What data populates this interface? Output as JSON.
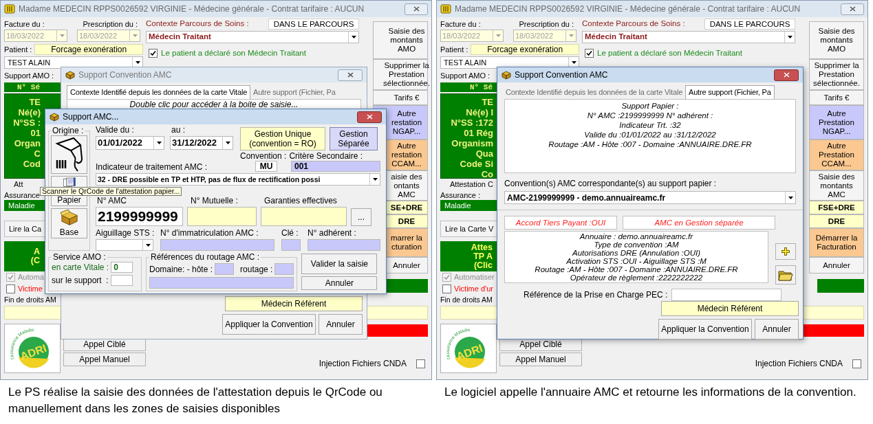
{
  "panels": [
    {
      "main_window": {
        "title": "Madame MEDECIN RPPS0026592 VIRGINIE - Médecine générale - Contrat tarifaire : AUCUN",
        "facture": {
          "label": "Facture du :",
          "value": "18/03/2022",
          "disabled": true
        },
        "prescription": {
          "label": "Prescription du :",
          "value": "18/03/2022",
          "disabled": true
        },
        "patient_label": "Patient :",
        "forcage_button": "Forcage exonération",
        "patient": "TEST ALAIN",
        "support_amo_label": "Support AMO :",
        "serie_bar": "N° Sé",
        "carte_lines": [
          "TE",
          "Né(e)",
          "N°SS :",
          "01",
          "Organ",
          "C",
          "Cod"
        ],
        "attestation_label": "Att",
        "assurance_label": "Assurance",
        "regime": "Maladie",
        "read_card_button": "Lire la Ca",
        "attestation_lines": [
          "A",
          "(C"
        ],
        "options": [
          {
            "label": "Automa",
            "checked": true,
            "disabled": true,
            "kind": "normal"
          },
          {
            "label": "Victime",
            "checked": false,
            "disabled": false,
            "kind": "alert"
          }
        ],
        "fin_droits": "Fin de droits AM",
        "parcours": {
          "label": "Contexte Parcours de Soins :",
          "status": "DANS LE PARCOURS",
          "value": "Médecin Traitant",
          "declared": {
            "label": "Le patient a déclaré son Médecin Traitant",
            "checked": true
          }
        },
        "side_buttons": [
          {
            "lines": [
              "Saisie des",
              "montants",
              "AMO"
            ],
            "kind": "plain"
          },
          {
            "lines": [
              "Supprimer la",
              "Prestation",
              "sélectionnée."
            ],
            "kind": "plain"
          },
          {
            "lines": [
              "Tarifs €"
            ],
            "kind": "plain"
          },
          {
            "lines": [
              "Autre",
              "restation",
              "NGAP..."
            ],
            "kind": "ngap"
          },
          {
            "lines": [
              "Autre",
              "restation",
              "CCAM..."
            ],
            "kind": "ccam"
          },
          {
            "lines": [
              "aisie des",
              "ontants",
              "AMC"
            ],
            "kind": "plain"
          },
          {
            "lines": [
              "SE+DRE"
            ],
            "kind": "yellow"
          },
          {
            "lines": [
              "DRE"
            ],
            "kind": "yellow"
          },
          {
            "lines": [
              "marrer la",
              "cturation"
            ],
            "kind": "ccam"
          },
          {
            "lines": [
              "Annuler"
            ],
            "kind": "plain"
          }
        ],
        "logo": {
          "arc": "l'Assurance Maladie",
          "name": "ADRI"
        },
        "call_buttons": [
          "Appel Ciblé",
          "Appel Manuel"
        ],
        "cnda": {
          "label": "Injection Fichiers CNDA",
          "checked": false
        }
      },
      "convention_dialog": {
        "title": "Support Convention AMC",
        "active": false,
        "tabs": [
          {
            "label": "Contexte Identifié depuis les données de la carte Vitale",
            "selected": true
          },
          {
            "label": "Autre support (Fichier, Pa",
            "selected": false
          }
        ],
        "hint": "Double clic pour accéder à la boite de saisie...",
        "referent_button": "Médecin Référent",
        "apply_button": "Appliquer la Convention",
        "cancel_button": "Annuler"
      },
      "amc_dialog": {
        "title": "Support AMC...",
        "origin_label": "Origine :",
        "origin_buttons": [
          {
            "kind": "scanner"
          },
          {
            "kind": "paper",
            "label": "Papier"
          },
          {
            "kind": "base",
            "label": "Base"
          }
        ],
        "valid_from": {
          "label": "Valide du :",
          "value": "01/01/2022"
        },
        "valid_to": {
          "label": "au :",
          "value": "31/12/2022"
        },
        "management": [
          {
            "lines": [
              "Gestion Unique",
              "(convention = RO)"
            ],
            "selected": false
          },
          {
            "lines": [
              "Gestion",
              "Séparée"
            ],
            "selected": true
          }
        ],
        "convention": {
          "label": "Convention :",
          "value": "MU"
        },
        "criterion": {
          "label": "Critère Secondaire :",
          "value": "001"
        },
        "indicator": {
          "label": "Indicateur de traitement AMC :",
          "value": "32 - DRE possible en TP et HTP, pas de flux de rectification possi"
        },
        "amc_number": {
          "label": "N° AMC",
          "value": "2199999999"
        },
        "mutual_label": "N° Mutuelle :",
        "guarantees_label": "Garanties effectives",
        "more_button": "...",
        "sts_label": "Aiguillage STS :",
        "immatriculation_label": "N° d'immatriculation AMC :",
        "key_label": "Clé :",
        "member_label": "N° adhérent :",
        "service_amo": {
          "label": "Service AMO :",
          "card_label": "en carte Vitale :",
          "card_value": "0",
          "support_label": "sur le support  :"
        },
        "routing": {
          "label": "Références du routage AMC :",
          "host_label": "Domaine: - hôte :",
          "routing_label": "routage :"
        },
        "validate_button": "Valider la saisie",
        "cancel_button": "Annuler"
      },
      "tooltip": "Scanner le QrCode de l'attestation papier...",
      "caption": "Le PS réalise la saisie des données de l'attestation depuis le QrCode ou manuellement dans les zones de saisies disponibles"
    },
    {
      "main_window": {
        "title": "Madame MEDECIN RPPS0026592 VIRGINIE - Médecine générale - Contrat tarifaire : AUCUN",
        "facture": {
          "label": "Facture du :",
          "value": "18/03/2022",
          "disabled": true
        },
        "prescription": {
          "label": "Prescription du :",
          "value": "18/03/2022",
          "disabled": true
        },
        "patient_label": "Patient :",
        "forcage_button": "Forcage exonération",
        "patient": "TEST ALAIN",
        "support_amo_label": "Support AMO :",
        "serie_bar": "N° Sé",
        "carte_lines": [
          "TE",
          "Né(e) l",
          "N°SS :172",
          "01 Rég",
          "Organism",
          "Qua",
          "Code Si",
          "Co"
        ],
        "attestation_label": "Attestation C",
        "assurance_label": "Assurance :",
        "regime": "Maladie",
        "read_card_button": "Lire la Carte V",
        "attestation_lines": [
          "Attes",
          "TP A",
          "(Clic"
        ],
        "options": [
          {
            "label": "Automatiser",
            "checked": true,
            "disabled": true,
            "kind": "normal"
          },
          {
            "label": "Victime d'ur",
            "checked": false,
            "disabled": false,
            "kind": "alert"
          }
        ],
        "fin_droits": "Fin de droits AM",
        "parcours": {
          "label": "Contexte Parcours de Soins :",
          "status": "DANS LE PARCOURS",
          "value": "Médecin Traitant",
          "declared": {
            "label": "Le patient a déclaré son Médecin Traitant",
            "checked": true
          }
        },
        "side_buttons": [
          {
            "lines": [
              "Saisie des",
              "montants",
              "AMO"
            ],
            "kind": "plain"
          },
          {
            "lines": [
              "Supprimer la",
              "Prestation",
              "sélectionnée."
            ],
            "kind": "plain"
          },
          {
            "lines": [
              "Tarifs €"
            ],
            "kind": "plain"
          },
          {
            "lines": [
              "Autre",
              "Prestation",
              "NGAP..."
            ],
            "kind": "ngap"
          },
          {
            "lines": [
              "Autre",
              "Prestation",
              "CCAM..."
            ],
            "kind": "ccam"
          },
          {
            "lines": [
              "Saisie des",
              "montants",
              "AMC"
            ],
            "kind": "plain"
          },
          {
            "lines": [
              "FSE+DRE"
            ],
            "kind": "yellow"
          },
          {
            "lines": [
              "DRE"
            ],
            "kind": "yellow"
          },
          {
            "lines": [
              "Démarrer la",
              "Facturation"
            ],
            "kind": "ccam"
          },
          {
            "lines": [
              "Annuler"
            ],
            "kind": "plain"
          }
        ],
        "logo": {
          "arc": "l'Assurance Maladie",
          "name": "ADRI"
        },
        "call_buttons": [
          "Appel Ciblé",
          "Appel Manuel"
        ],
        "cnda": {
          "label": "Injection Fichiers CNDA",
          "checked": false
        }
      },
      "convention_dialog": {
        "title": "Support Convention AMC",
        "active": true,
        "tabs": [
          {
            "label": "Contexte Identifié depuis les données de la carte Vitale",
            "selected": false
          },
          {
            "label": "Autre support (Fichier, Pa",
            "selected": true
          }
        ],
        "support_lines": [
          "Support Papier :",
          "N° AMC :2199999999 N° adhérent :",
          "Indicateur Trt. :32",
          "Valide du :01/01/2022 au :31/12/2022",
          "Routage :AM - Hôte :007 - Domaine :ANNUAIRE.DRE.FR"
        ],
        "conventions_label": "Convention(s) AMC correspondante(s) au support papier :",
        "convention_value": "AMC-2199999999 - demo.annuaireamc.fr",
        "flags": [
          "Accord Tiers Payant :OUI",
          "AMC en Gestion séparée"
        ],
        "details": [
          "Annuaire : demo.annuaireamc.fr",
          "Type de convention :AM",
          "Autorisations DRE (Annulation :OUI)",
          "Activation STS :OUI - Aiguillage STS :M",
          "Routage :AM - Hôte :007 - Domaine :ANNUAIRE.DRE.FR",
          "Opérateur de règlement :2222222222"
        ],
        "pec_label": "Référence de la Prise en Charge PEC :",
        "referent_button": "Médecin Référent",
        "apply_button": "Appliquer la Convention",
        "cancel_button": "Annuler"
      },
      "caption": "Le logiciel appelle l'annuaire AMC et retourne les informations de la convention."
    }
  ]
}
